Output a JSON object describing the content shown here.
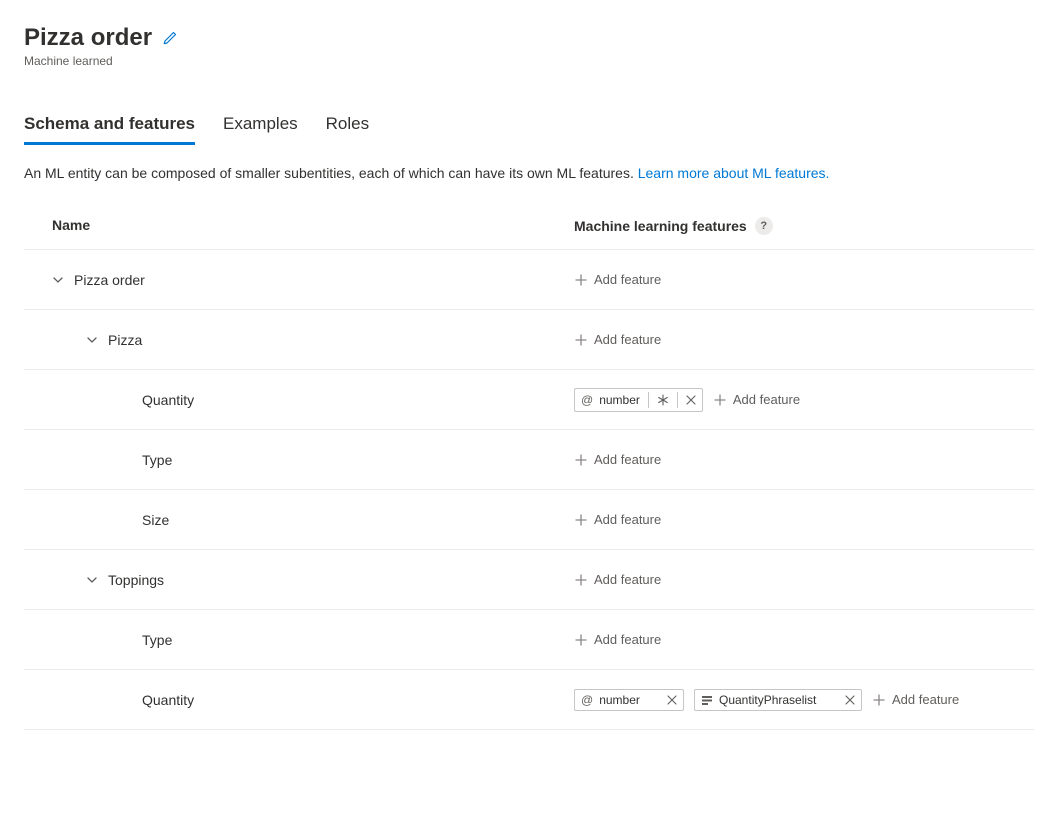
{
  "header": {
    "title": "Pizza order",
    "subtitle": "Machine learned"
  },
  "tabs": {
    "schema": "Schema and features",
    "examples": "Examples",
    "roles": "Roles"
  },
  "description": {
    "text": "An ML entity can be composed of smaller subentities, each of which can have its own ML features. ",
    "link": "Learn more about ML features."
  },
  "columns": {
    "name": "Name",
    "ml": "Machine learning features"
  },
  "addFeatureLabel": "Add feature",
  "rows": {
    "r0": {
      "name": "Pizza order"
    },
    "r1": {
      "name": "Pizza"
    },
    "r2": {
      "name": "Quantity",
      "chip1": "number"
    },
    "r3": {
      "name": "Type"
    },
    "r4": {
      "name": "Size"
    },
    "r5": {
      "name": "Toppings"
    },
    "r6": {
      "name": "Type"
    },
    "r7": {
      "name": "Quantity",
      "chip1": "number",
      "chip2": "QuantityPhraselist"
    }
  }
}
